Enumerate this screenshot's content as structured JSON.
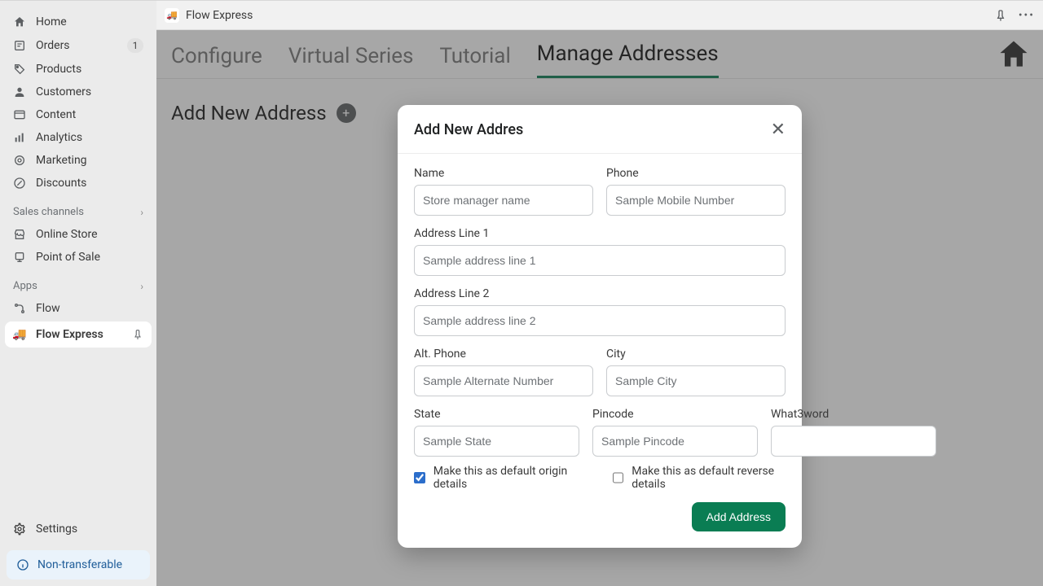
{
  "topbar": {
    "app_title": "Flow Express"
  },
  "sidebar": {
    "items": [
      {
        "label": "Home"
      },
      {
        "label": "Orders",
        "badge": "1"
      },
      {
        "label": "Products"
      },
      {
        "label": "Customers"
      },
      {
        "label": "Content"
      },
      {
        "label": "Analytics"
      },
      {
        "label": "Marketing"
      },
      {
        "label": "Discounts"
      }
    ],
    "channels_title": "Sales channels",
    "channels": [
      {
        "label": "Online Store"
      },
      {
        "label": "Point of Sale"
      }
    ],
    "apps_title": "Apps",
    "apps": [
      {
        "label": "Flow"
      }
    ],
    "selected_app": {
      "label": "Flow Express"
    },
    "settings_label": "Settings",
    "nontransferable_label": "Non-transferable"
  },
  "tabs": {
    "items": [
      {
        "label": "Configure"
      },
      {
        "label": "Virtual Series"
      },
      {
        "label": "Tutorial"
      },
      {
        "label": "Manage Addresses"
      }
    ],
    "active_index": 3
  },
  "page": {
    "heading": "Add New Address"
  },
  "modal": {
    "title": "Add New Addres",
    "fields": {
      "name": {
        "label": "Name",
        "placeholder": "Store manager name"
      },
      "phone": {
        "label": "Phone",
        "placeholder": "Sample Mobile Number"
      },
      "addr1": {
        "label": "Address Line 1",
        "placeholder": "Sample address line 1"
      },
      "addr2": {
        "label": "Address Line 2",
        "placeholder": "Sample address line 2"
      },
      "altphone": {
        "label": "Alt. Phone",
        "placeholder": "Sample Alternate Number"
      },
      "city": {
        "label": "City",
        "placeholder": "Sample City"
      },
      "state": {
        "label": "State",
        "placeholder": "Sample State"
      },
      "pincode": {
        "label": "Pincode",
        "placeholder": "Sample Pincode"
      },
      "w3w": {
        "label": "What3word",
        "placeholder": ""
      }
    },
    "check_origin": "Make this as default origin details",
    "check_reverse": "Make this as default reverse details",
    "submit_label": "Add Address"
  }
}
